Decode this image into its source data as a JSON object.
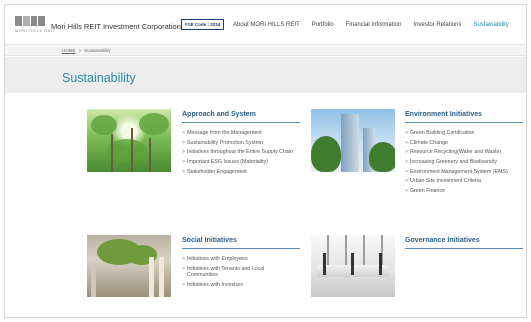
{
  "header": {
    "logo_text": "MORI HILLS REIT",
    "corp_name": "Mori Hills REIT Investment Corporation",
    "fse_code": "FSE Code : 3234",
    "nav": [
      {
        "label": "About MORI HILLS REIT"
      },
      {
        "label": "Portfolio"
      },
      {
        "label": "Financial Information"
      },
      {
        "label": "Investor Relations"
      },
      {
        "label": "Sustainability"
      }
    ],
    "active_nav": "Sustainability"
  },
  "breadcrumb": {
    "home": "HOME",
    "separator": ">",
    "current": "Sustainability"
  },
  "page_title": "Sustainability",
  "sections": {
    "approach": {
      "title": "Approach and System",
      "links": [
        "Message from the Management",
        "Sustainability Promotion System",
        "Initiatives throughout the Entire Supply Chain",
        "Important ESG Issues (Materiality)",
        "Stakeholder Engagement"
      ]
    },
    "environment": {
      "title": "Environment Initiatives",
      "links": [
        "Green Building Certification",
        "Climate Change",
        "Resource Recycling(Water and Waste)",
        "Increasing Greenery and Biodiversity",
        "Environment Management System (EMS)",
        "Urban Site Investment Criteria",
        "Green Finance"
      ]
    },
    "social": {
      "title": "Social Initiatives",
      "links": [
        "Initiatives with Employees",
        "Initiatives with Tenants and Local Communities",
        "Initiatives with Investors"
      ]
    },
    "governance": {
      "title": "Governance Initiatives",
      "links": []
    }
  },
  "colors": {
    "accent": "#2a8aa6",
    "section_title": "#2b5e8c",
    "fse_border": "#1a3f7a"
  },
  "icons": {
    "logo": "mori-hills-logo-icon",
    "link_marker": "chevron-right-icon"
  }
}
